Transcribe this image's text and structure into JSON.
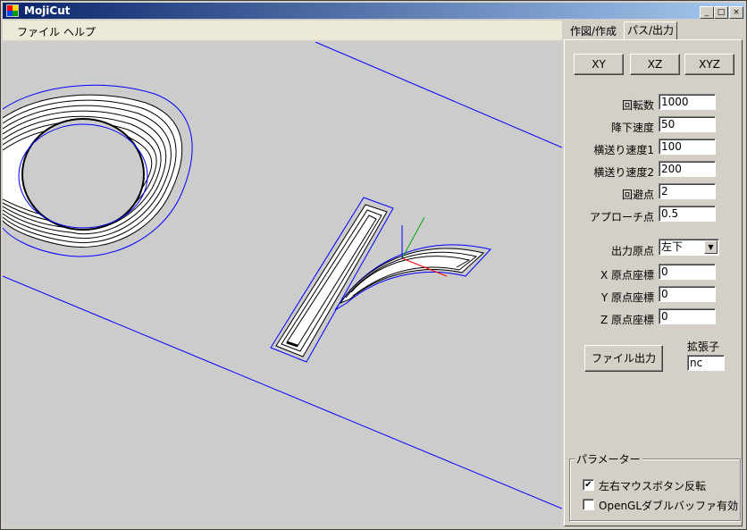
{
  "window": {
    "title": "MojiCut",
    "controls": {
      "minimize": "_",
      "maximize": "□",
      "close": "×"
    }
  },
  "menu": {
    "items": [
      "ファイル",
      "ヘルプ"
    ]
  },
  "tabs": [
    {
      "label": "作図/作成",
      "active": false
    },
    {
      "label": "パス/出力",
      "active": true
    }
  ],
  "view_buttons": [
    "XY",
    "XZ",
    "XYZ"
  ],
  "fields": [
    {
      "label": "回転数",
      "value": "1000"
    },
    {
      "label": "降下速度",
      "value": "50"
    },
    {
      "label": "横送り速度1",
      "value": "100"
    },
    {
      "label": "横送り速度2",
      "value": "200"
    },
    {
      "label": "回避点",
      "value": "2"
    },
    {
      "label": "アプローチ点",
      "value": "0.5"
    }
  ],
  "origin": {
    "label": "出力原点",
    "selected": "左下"
  },
  "coords": [
    {
      "label": "X 原点座標",
      "value": "0"
    },
    {
      "label": "Y 原点座標",
      "value": "0"
    },
    {
      "label": "Z 原点座標",
      "value": "0"
    }
  ],
  "output": {
    "button_label": "ファイル出力",
    "ext_label": "拡張子",
    "ext_value": "nc"
  },
  "params": {
    "title": "パラメーター",
    "options": [
      {
        "label": "左右マウスボタン反転",
        "checked": true
      },
      {
        "label": "OpenGLダブルバッファ有効",
        "checked": false
      }
    ]
  },
  "colors": {
    "titlebar_start": "#0a246a",
    "titlebar_end": "#a6caf0",
    "outline": "#0000ff",
    "axis_x": "#ff0000",
    "axis_y": "#00aa00",
    "axis_z": "#0000ff",
    "viewport_bg": "#cccccc"
  }
}
